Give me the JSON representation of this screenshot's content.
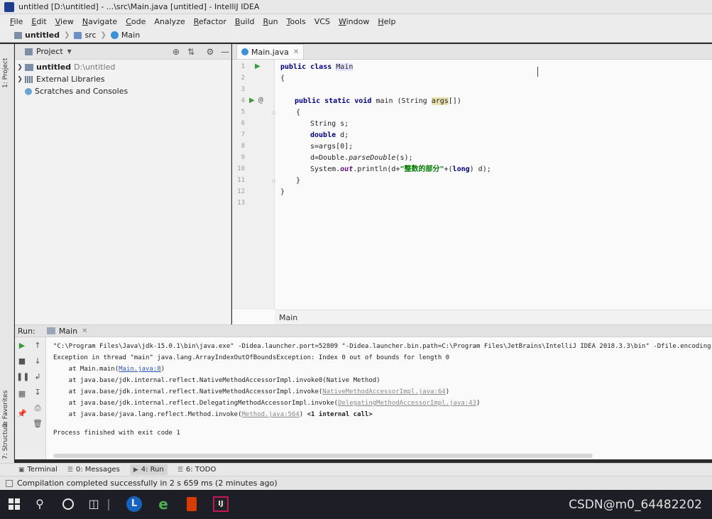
{
  "window": {
    "title": "untitled [D:\\untitled] - ...\\src\\Main.java [untitled] - IntelliJ IDEA"
  },
  "menu": [
    {
      "label": "File",
      "u": "F",
      "rest": "ile"
    },
    {
      "label": "Edit",
      "u": "E",
      "rest": "dit"
    },
    {
      "label": "View",
      "u": "V",
      "rest": "iew"
    },
    {
      "label": "Navigate",
      "u": "N",
      "rest": "avigate"
    },
    {
      "label": "Code",
      "u": "C",
      "rest": "ode"
    },
    {
      "label": "Analyze",
      "u": "",
      "rest": "Analyze"
    },
    {
      "label": "Refactor",
      "u": "R",
      "rest": "efactor"
    },
    {
      "label": "Build",
      "u": "B",
      "rest": "uild"
    },
    {
      "label": "Run",
      "u": "R",
      "rest": "un"
    },
    {
      "label": "Tools",
      "u": "T",
      "rest": "ools"
    },
    {
      "label": "VCS",
      "u": "",
      "rest": "VCS"
    },
    {
      "label": "Window",
      "u": "W",
      "rest": "indow"
    },
    {
      "label": "Help",
      "u": "H",
      "rest": "elp"
    }
  ],
  "breadcrumb": {
    "project": "untitled",
    "src": "src",
    "file": "Main"
  },
  "sidebar_strip": {
    "project_label": "1: Project",
    "favorites_label": "2: Favorites",
    "structure_label": "7: Structure"
  },
  "project_panel": {
    "title": "Project",
    "tree": {
      "root_name": "untitled",
      "root_path": "D:\\untitled",
      "external": "External Libraries",
      "scratches": "Scratches and Consoles"
    }
  },
  "editor": {
    "tab_label": "Main.java",
    "footer": "Main",
    "line_numbers": [
      "1",
      "2",
      "3",
      "4",
      "5",
      "6",
      "7",
      "8",
      "9",
      "10",
      "11",
      "12",
      "13"
    ],
    "code": {
      "l1_kw": "public class",
      "l1_name": "Main",
      "l2": "{",
      "l4_kw": "public static void",
      "l4_mid": "main (String",
      "l4_args": "args",
      "l4_end": "[])",
      "l5": "{",
      "l6": "String s;",
      "l7_kw": "double",
      "l7_rest": "d;",
      "l8": "s=args[0];",
      "l9_a": "d=Double.",
      "l9_b": "parseDouble",
      "l9_c": "(s);",
      "l10_a": "System.",
      "l10_b": "out",
      "l10_c": ".println(d+",
      "l10_str": "\"整数的部分\"",
      "l10_d": "+(",
      "l10_kw": "long",
      "l10_e": ") d);",
      "l11": "}",
      "l12": "}"
    }
  },
  "run_panel": {
    "label": "Run:",
    "tab": "Main",
    "output": {
      "cmd": "\"C:\\Program Files\\Java\\jdk-15.0.1\\bin\\java.exe\" -Didea.launcher.port=52809 \"-Didea.launcher.bin.path=C:\\Program Files\\JetBrains\\IntelliJ IDEA 2018.3.3\\bin\" -Dfile.encoding",
      "exception": "Exception in thread \"main\" java.lang.ArrayIndexOutOfBoundsException: Index 0 out of bounds for length 0",
      "t1_a": "    at Main.main(",
      "t1_link": "Main.java:8",
      "t1_b": ")",
      "t2": "    at java.base/jdk.internal.reflect.NativeMethodAccessorImpl.invoke0(Native Method)",
      "t3_a": "    at java.base/jdk.internal.reflect.NativeMethodAccessorImpl.invoke(",
      "t3_link": "NativeMethodAccessorImpl.java:64",
      "t3_b": ")",
      "t4_a": "    at java.base/jdk.internal.reflect.DelegatingMethodAccessorImpl.invoke(",
      "t4_link": "DelegatingMethodAccessorImpl.java:43",
      "t4_b": ")",
      "t5_a": "    at java.base/java.lang.reflect.Method.invoke(",
      "t5_link": "Method.java:564",
      "t5_b": ")",
      "t5_internal": "<1 internal call>",
      "finished": "Process finished with exit code 1"
    }
  },
  "bottom_tabs": {
    "terminal": "Terminal",
    "messages": "0: Messages",
    "run": "4: Run",
    "todo": "6: TODO"
  },
  "status": {
    "text": "Compilation completed successfully in 2 s 659 ms (2 minutes ago)"
  },
  "taskbar": {
    "watermark": "CSDN@m0_64482202"
  },
  "colors": {
    "keyword": "#000080",
    "string": "#007a00",
    "link": "#2a55b5",
    "run_green": "#3a9a3a"
  }
}
